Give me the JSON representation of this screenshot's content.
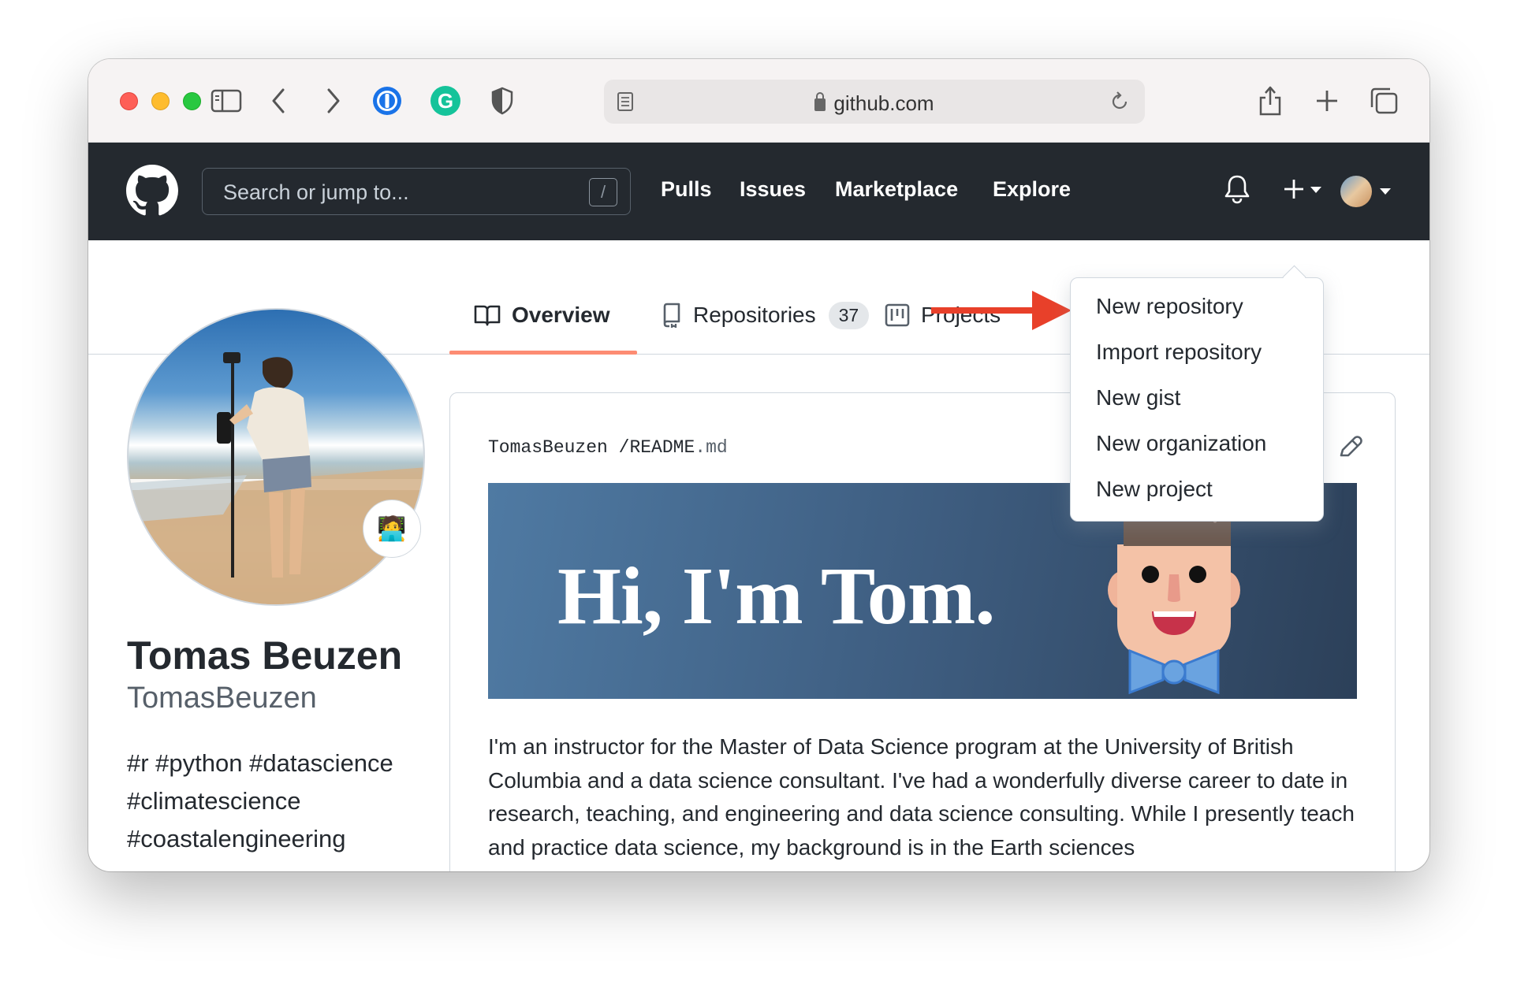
{
  "browser": {
    "url": "github.com",
    "icons": [
      "sidebar-icon",
      "back-icon",
      "forward-icon",
      "onepassword-icon",
      "grammarly-icon",
      "privacy-shield-icon",
      "reader-icon",
      "reload-icon",
      "share-icon",
      "new-tab-icon",
      "tab-overview-icon"
    ]
  },
  "header": {
    "search_placeholder": "Search or jump to...",
    "search_shortcut": "/",
    "nav": [
      "Pulls",
      "Issues",
      "Marketplace",
      "Explore"
    ]
  },
  "tabs": {
    "overview": "Overview",
    "repositories": "Repositories",
    "repositories_count": "37",
    "projects": "Projects"
  },
  "profile": {
    "name": "Tomas Beuzen",
    "login": "TomasBeuzen",
    "bio_lines": [
      "#r #python #datascience",
      "#climatescience",
      "#coastalengineering"
    ],
    "status_emoji": "🧑‍💻"
  },
  "readme": {
    "owner": "TomasBeuzen",
    "separator": "/",
    "file_base": "README",
    "file_ext": ".md",
    "banner_title": "Hi, I'm Tom.",
    "paragraph": "I'm an instructor for the Master of Data Science program at the University of British Columbia and a data science consultant. I've had a wonderfully diverse career to date in research, teaching, and engineering and data science consulting. While I presently teach and practice data science, my background is in the Earth sciences"
  },
  "dropdown": {
    "items": [
      "New repository",
      "Import repository",
      "New gist",
      "New organization",
      "New project"
    ]
  },
  "colors": {
    "header_bg": "#24292f",
    "tab_underline": "#fd8c73",
    "annotation_arrow": "#e8402a"
  }
}
